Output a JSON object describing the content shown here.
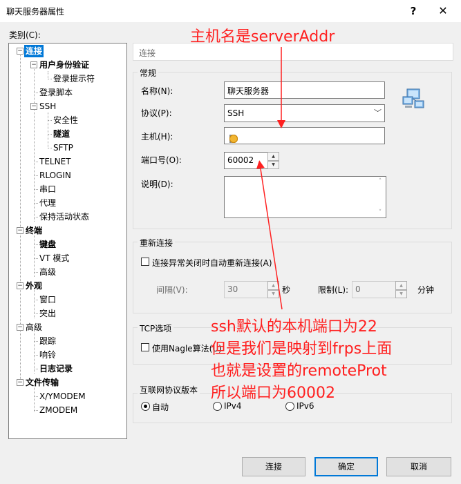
{
  "window": {
    "title": "聊天服务器属性",
    "help_label": "?",
    "close_label": "✕"
  },
  "category_label": "类别(C):",
  "tree": [
    {
      "label": "连接",
      "depth": 0,
      "bold": true,
      "selected": true
    },
    {
      "label": "用户身份验证",
      "depth": 1,
      "bold": true
    },
    {
      "label": "登录提示符",
      "depth": 2
    },
    {
      "label": "登录脚本",
      "depth": 1
    },
    {
      "label": "SSH",
      "depth": 1
    },
    {
      "label": "安全性",
      "depth": 2
    },
    {
      "label": "隧道",
      "depth": 2,
      "bold": true
    },
    {
      "label": "SFTP",
      "depth": 2
    },
    {
      "label": "TELNET",
      "depth": 1
    },
    {
      "label": "RLOGIN",
      "depth": 1
    },
    {
      "label": "串口",
      "depth": 1
    },
    {
      "label": "代理",
      "depth": 1
    },
    {
      "label": "保持活动状态",
      "depth": 1
    },
    {
      "label": "终端",
      "depth": 0,
      "bold": true
    },
    {
      "label": "键盘",
      "depth": 1,
      "bold": true
    },
    {
      "label": "VT 模式",
      "depth": 1
    },
    {
      "label": "高级",
      "depth": 1
    },
    {
      "label": "外观",
      "depth": 0,
      "bold": true
    },
    {
      "label": "窗口",
      "depth": 1
    },
    {
      "label": "突出",
      "depth": 1
    },
    {
      "label": "高级",
      "depth": 0
    },
    {
      "label": "跟踪",
      "depth": 1
    },
    {
      "label": "响铃",
      "depth": 1
    },
    {
      "label": "日志记录",
      "depth": 1,
      "bold": true
    },
    {
      "label": "文件传输",
      "depth": 0,
      "bold": true
    },
    {
      "label": "X/YMODEM",
      "depth": 1
    },
    {
      "label": "ZMODEM",
      "depth": 1
    }
  ],
  "section_header": "连接",
  "general": {
    "title": "常规",
    "name_label": "名称(N):",
    "name_value": "聊天服务器",
    "protocol_label": "协议(P):",
    "protocol_value": "SSH",
    "host_label": "主机(H):",
    "port_label": "端口号(O):",
    "port_value": "60002",
    "desc_label": "说明(D):"
  },
  "reconnect": {
    "title": "重新连接",
    "auto_label": "连接异常关闭时自动重新连接(A)",
    "interval_label": "间隔(V):",
    "interval_value": "30",
    "interval_unit": "秒",
    "limit_label": "限制(L):",
    "limit_value": "0",
    "limit_unit": "分钟"
  },
  "tcp": {
    "title": "TCP选项",
    "nagle_label": "使用Nagle算法(U)"
  },
  "ipver": {
    "title": "互联网协议版本",
    "options": [
      "自动",
      "IPv4",
      "IPv6"
    ],
    "selected": "自动"
  },
  "buttons": {
    "connect": "连接",
    "ok": "确定",
    "cancel": "取消"
  },
  "annotations": {
    "host_note": "主机名是serverAddr",
    "port_note": [
      "ssh默认的本机端口为22",
      "但是我们是映射到frps上面",
      "也就是设置的remoteProt",
      "所以端口为60002"
    ]
  },
  "colors": {
    "accent": "#0078d7",
    "annotation": "#ff2020"
  }
}
